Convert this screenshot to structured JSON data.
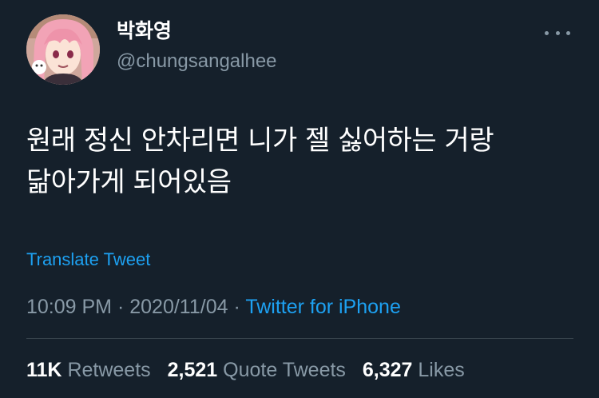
{
  "user": {
    "display_name": "박화영",
    "handle": "@chungsangalhee",
    "avatar_icon": "anime-character-avatar-icon"
  },
  "tweet": {
    "lines": [
      "원래 정신 안차리면 니가 젤 싫어하는 거랑",
      "닮아가게 되어있음"
    ],
    "translate_label": "Translate Tweet",
    "time": "10:09 PM",
    "date": "2020/11/04",
    "separator": "·",
    "source": "Twitter for iPhone"
  },
  "stats": {
    "retweets_count": "11K",
    "retweets_label": "Retweets",
    "quote_count": "2,521",
    "quote_label": "Quote Tweets",
    "likes_count": "6,327",
    "likes_label": "Likes"
  },
  "colors": {
    "background": "#15202b",
    "text": "#ffffff",
    "secondary": "#8899a6",
    "accent": "#1da1f2",
    "divider": "#38444d"
  }
}
